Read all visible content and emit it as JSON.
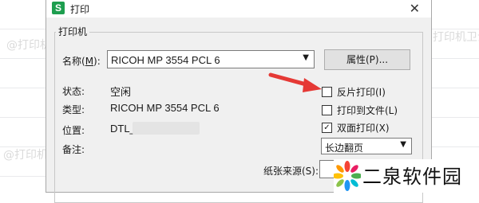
{
  "window": {
    "title": "打印",
    "app_icon_letter": "S",
    "close_glyph": "✕"
  },
  "printer": {
    "group_label": "打印机",
    "name_label": "名称(",
    "name_hotkey": "M",
    "name_label_end": "):",
    "name_value": "RICOH MP 3554 PCL 6",
    "properties_button": "属性(P)...",
    "status_label": "状态:",
    "status_value": "空闲",
    "type_label": "类型:",
    "type_value": "RICOH MP 3554 PCL 6",
    "location_label": "位置:",
    "location_value": "DTL_",
    "comment_label": "备注:",
    "paper_source_label": "纸张来源(S):"
  },
  "options": {
    "reverse_print": {
      "label": "反片打印(I)",
      "checked": false
    },
    "print_to_file": {
      "label": "打印到文件(L)",
      "checked": false
    },
    "duplex": {
      "label": "双面打印(X)",
      "checked": true
    },
    "duplex_mode": "长边翻页"
  },
  "watermarks": [
    "@打印机卫士",
    "@打印机卫士",
    "@打印机卫士",
    "@打印机卫士",
    "@打印机卫士",
    "@打印机卫士"
  ],
  "brand": {
    "text": "二泉软件园"
  },
  "colors": {
    "arrow": "#e53935",
    "app_icon": "#1e9e4f"
  }
}
